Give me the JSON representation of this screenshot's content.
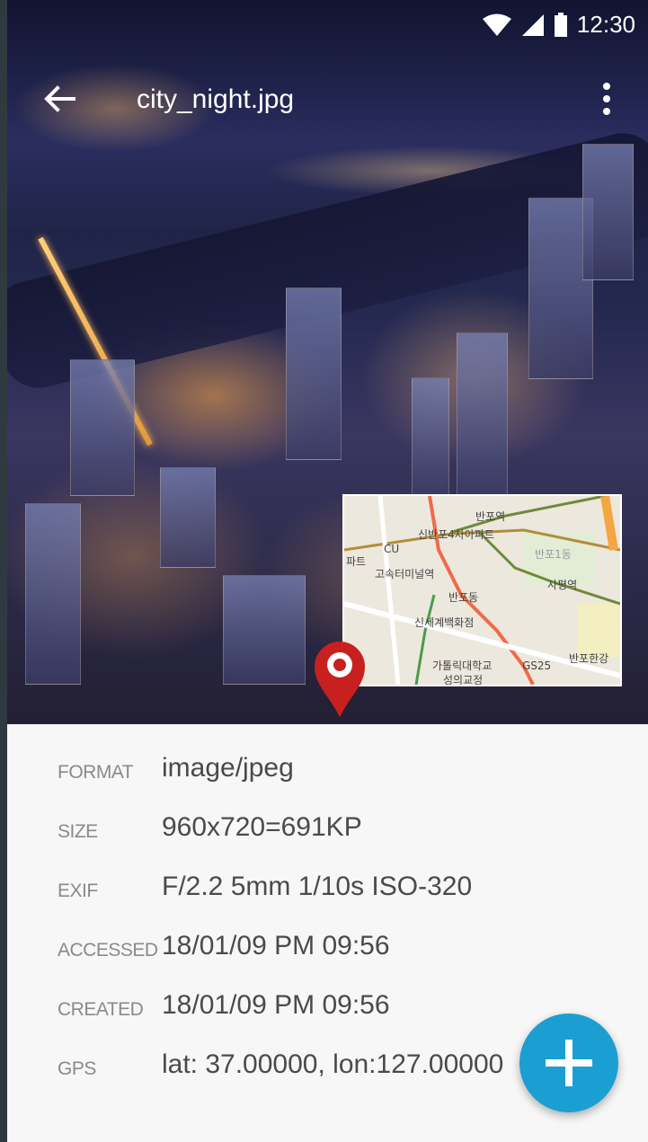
{
  "status_bar": {
    "time": "12:30"
  },
  "header": {
    "title": "city_night.jpg"
  },
  "map": {
    "labels": [
      "반포역",
      "신반포4차아파트",
      "CU",
      "파트",
      "반포1동",
      "고속터미널역",
      "반포동",
      "사평역",
      "신세계백화점",
      "가톨릭대학교",
      "성의교정",
      "GS25",
      "반포한강"
    ]
  },
  "details": [
    {
      "label": "FORMAT",
      "value": "image/jpeg"
    },
    {
      "label": "SIZE",
      "value": "960x720=691KP"
    },
    {
      "label": "EXIF",
      "value": "F/2.2 5mm 1/10s ISO-320"
    },
    {
      "label": "ACCESSED",
      "value": "18/01/09 PM 09:56"
    },
    {
      "label": "CREATED",
      "value": "18/01/09 PM 09:56"
    },
    {
      "label": "GPS",
      "value": "lat: 37.00000, lon:127.00000"
    }
  ],
  "colors": {
    "fab": "#1b9fd3",
    "pin": "#c8201e",
    "label": "#8a8a8a",
    "value": "#4a4a4a"
  }
}
